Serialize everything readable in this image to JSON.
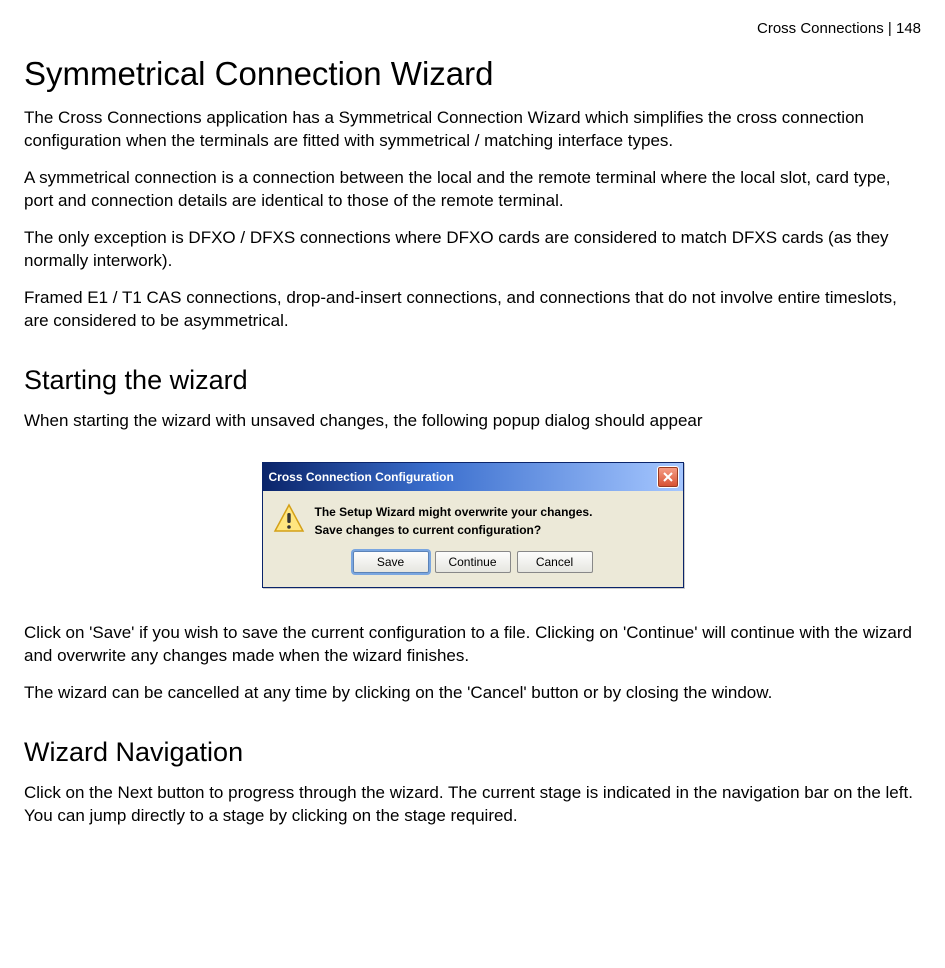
{
  "header": {
    "breadcrumb": "Cross Connections  |  148"
  },
  "section1": {
    "title": "Symmetrical Connection Wizard",
    "p1": "The Cross Connections application has a Symmetrical Connection Wizard which simplifies the cross connection configuration when the terminals are fitted with symmetrical / matching interface types.",
    "p2": "A symmetrical connection is a connection between the local and the remote terminal where the local slot, card type, port and connection details are identical to those of the remote terminal.",
    "p3": "The only exception is DFXO / DFXS connections where DFXO cards are considered to match DFXS cards (as they normally interwork).",
    "p4": "Framed E1 / T1 CAS connections, drop-and-insert connections, and connections that do not involve entire timeslots, are considered to be asymmetrical."
  },
  "section2": {
    "title": "Starting the wizard",
    "p1": "When starting the wizard with unsaved changes, the following popup dialog should appear"
  },
  "dialog": {
    "title": "Cross Connection Configuration",
    "line1": "The Setup Wizard might overwrite your changes.",
    "line2": "Save changes to current configuration?",
    "buttons": {
      "save": "Save",
      "continue": "Continue",
      "cancel": "Cancel"
    }
  },
  "section3": {
    "p1": "Click on 'Save' if you wish to save the current configuration to a file. Clicking on 'Continue' will continue with the wizard and overwrite any changes made when the wizard finishes.",
    "p2": "The wizard can be cancelled at any time by clicking on the 'Cancel' button or by closing the window."
  },
  "section4": {
    "title": "Wizard Navigation",
    "p1": "Click on the Next button to progress through the wizard. The current stage is indicated in the navigation bar on the left. You can jump directly to a stage by clicking on the stage required."
  }
}
